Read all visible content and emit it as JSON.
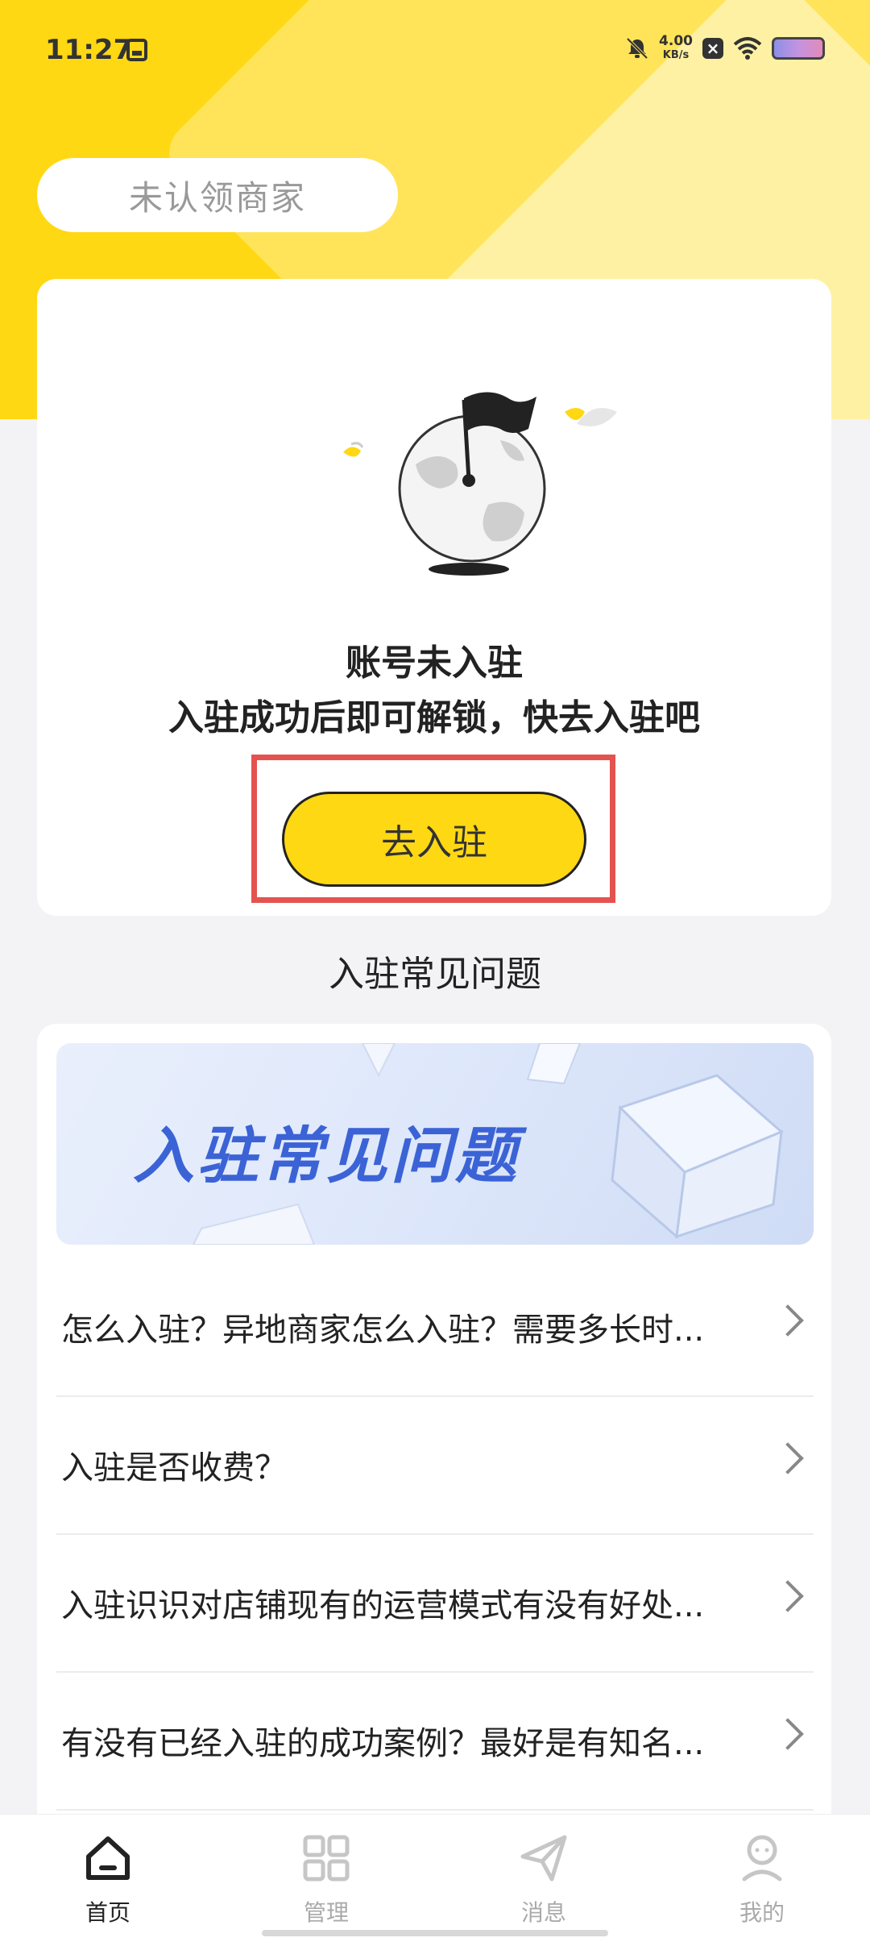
{
  "status_bar": {
    "time": "11:27",
    "speed_value": "4.00",
    "speed_unit": "KB/s"
  },
  "merchant_status": "未认领商家",
  "onboarding_card": {
    "title": "账号未入驻",
    "subtitle": "入驻成功后即可解锁，快去入驻吧",
    "button_label": "去入驻"
  },
  "faq": {
    "heading": "入驻常见问题",
    "banner_text": "入驻常见问题",
    "items": [
      {
        "question": "怎么入驻？异地商家怎么入驻？需要多长时..."
      },
      {
        "question": "入驻是否收费？"
      },
      {
        "question": "入驻识识对店铺现有的运营模式有没有好处..."
      },
      {
        "question": "有没有已经入驻的成功案例？最好是有知名..."
      }
    ]
  },
  "tabbar": {
    "items": [
      {
        "label": "首页",
        "icon": "home-icon",
        "active": true
      },
      {
        "label": "管理",
        "icon": "grid-icon",
        "active": false
      },
      {
        "label": "消息",
        "icon": "paper-plane-icon",
        "active": false
      },
      {
        "label": "我的",
        "icon": "profile-icon",
        "active": false
      }
    ]
  },
  "colors": {
    "brand_yellow": "#ffd814",
    "highlight_red": "#e4534f",
    "banner_blue": "#3b63d6"
  }
}
